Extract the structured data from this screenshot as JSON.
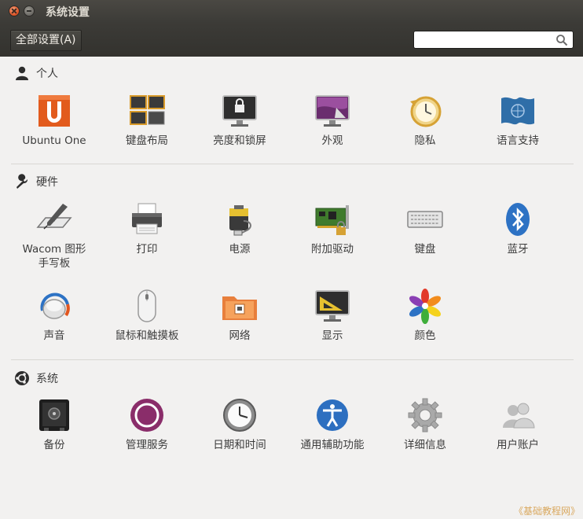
{
  "window": {
    "title": "系统设置"
  },
  "toolbar": {
    "all_settings_label": "全部设置(A)",
    "search_placeholder": ""
  },
  "sections": {
    "personal": {
      "label": "个人",
      "items": [
        "Ubuntu One",
        "键盘布局",
        "亮度和锁屏",
        "外观",
        "隐私",
        "语言支持"
      ]
    },
    "hardware": {
      "label": "硬件",
      "items": [
        "Wacom 图形\n手写板",
        "打印",
        "电源",
        "附加驱动",
        "键盘",
        "蓝牙",
        "声音",
        "鼠标和触摸板",
        "网络",
        "显示",
        "颜色"
      ]
    },
    "system": {
      "label": "系统",
      "items": [
        "备份",
        "管理服务",
        "日期和时间",
        "通用辅助功能",
        "详细信息",
        "用户账户"
      ]
    }
  },
  "watermark": "《基础教程网》",
  "colors": {
    "titlebar": "#3c3b37",
    "close_button": "#e0592c",
    "background": "#f2f1f0"
  }
}
